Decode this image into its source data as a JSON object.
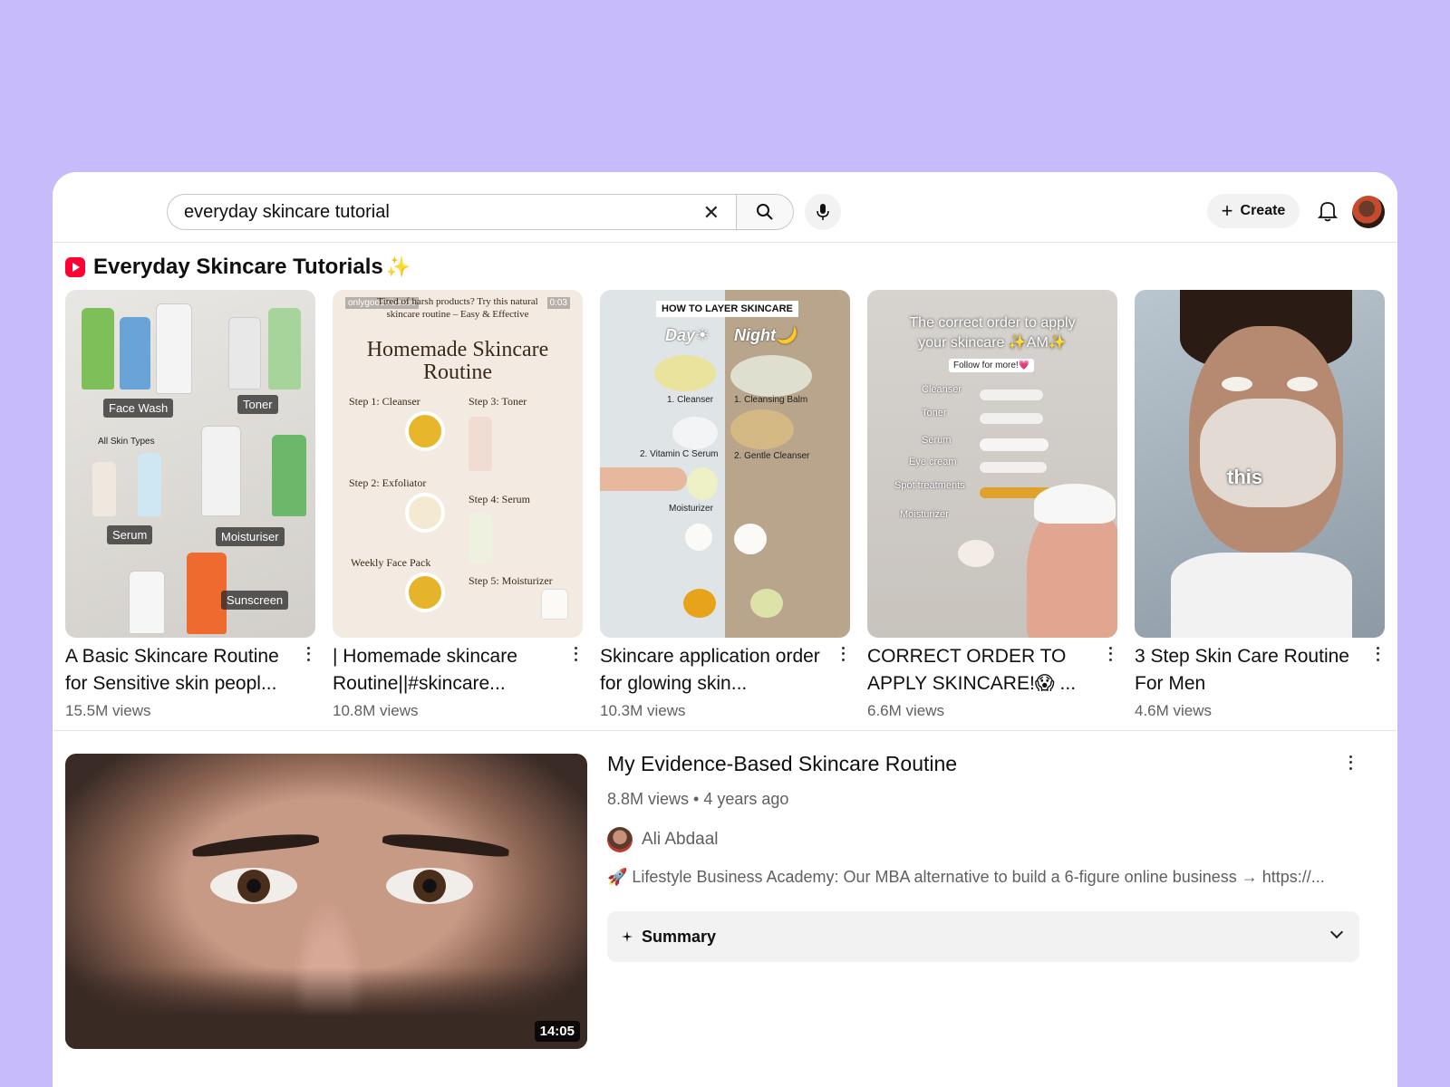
{
  "search": {
    "value": "everyday skincare tutorial"
  },
  "header": {
    "create_label": "Create"
  },
  "shorts_section": {
    "title": "Everyday Skincare Tutorials",
    "sparkle": "✨",
    "items": [
      {
        "title": "A Basic Skincare Routine for Sensitive skin peopl...",
        "views": "15.5M views",
        "thumb_text": [
          "Face Wash",
          "Toner",
          "Serum",
          "Moisturiser",
          "Sunscreen",
          "All Skin Types"
        ]
      },
      {
        "title": "| Homemade skincare Routine||#skincare...",
        "views": "10.8M views",
        "thumb_text": {
          "handle": "onlygoodvibesoo",
          "time": "0:03",
          "tagline": "Tired of harsh products? Try this natural skincare routine – Easy & Effective",
          "heading": "Homemade Skincare Routine",
          "steps": [
            "Step 1: Cleanser",
            "Step 2: Exfoliator",
            "Step 3: Toner",
            "Step 4: Serum",
            "Step 5: Moisturizer",
            "Weekly Face Pack"
          ]
        }
      },
      {
        "title": "Skincare application order for glowing skin...",
        "views": "10.3M views",
        "thumb_text": {
          "banner": "HOW TO LAYER SKINCARE",
          "day": "Day☀",
          "night": "Night🌙",
          "left": [
            "1. Cleanser",
            "2. Vitamin C Serum",
            "Moisturizer"
          ],
          "right": [
            "1. Cleansing Balm",
            "2. Gentle Cleanser"
          ]
        }
      },
      {
        "title": "CORRECT ORDER TO APPLY SKINCARE!😱 ...",
        "views": "6.6M views",
        "thumb_text": {
          "heading": "The correct order to apply your skincare ✨AM✨",
          "follow": "Follow for more!💗",
          "steps": [
            "Cleanser",
            "Toner",
            "Serum",
            "Eye cream",
            "Spot treatments",
            "Moisturizer"
          ]
        }
      },
      {
        "title": "3 Step Skin Care Routine For Men",
        "views": "4.6M views",
        "thumb_text": {
          "caption": "this"
        }
      }
    ]
  },
  "featured_video": {
    "title": "My Evidence-Based Skincare Routine",
    "meta": "8.8M views • 4 years ago",
    "channel": "Ali Abdaal",
    "description": "🚀 Lifestyle Business Academy: Our MBA alternative to build a 6-figure online business → https://...",
    "duration": "14:05",
    "summary_label": "Summary"
  },
  "icons": {
    "clear": "close-icon",
    "search": "search-icon",
    "mic": "microphone-icon",
    "create": "plus-icon",
    "notifications": "bell-icon",
    "shorts": "shorts-icon",
    "summary": "sparkle-icon",
    "expand": "chevron-down-icon",
    "more": "more-vertical-icon"
  },
  "colors": {
    "background": "#c8bbfb",
    "brand_red": "#ff0033",
    "surface": "#ffffff",
    "chip": "#f2f2f2"
  }
}
